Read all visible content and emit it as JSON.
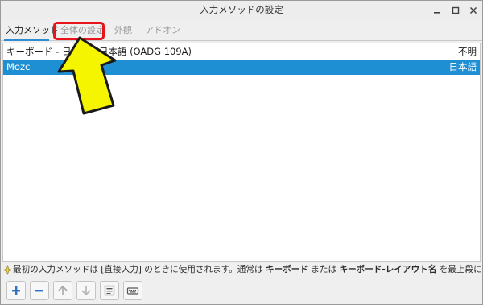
{
  "window": {
    "title": "入力メソッドの設定"
  },
  "tabs": [
    {
      "label": "入力メソッド",
      "active": true
    },
    {
      "label": "全体の設定",
      "active": false,
      "highlighted": true
    },
    {
      "label": "外観",
      "active": false
    },
    {
      "label": "アドオン",
      "active": false
    }
  ],
  "methods": [
    {
      "name": "キーボード - 日本語 - 日本語 (OADG 109A)",
      "language": "不明",
      "selected": false
    },
    {
      "name": "Mozc",
      "language": "日本語",
      "selected": true
    }
  ],
  "hint": {
    "prefix": "最初の入力メソッドは [直接入力] のときに使用されます。通常は ",
    "bold1": "キーボード",
    "mid": " または ",
    "bold2": "キーボード-レイアウト名",
    "suffix": " を最上段に指定してください。"
  },
  "toolbar": {
    "icons": [
      "add-icon",
      "remove-icon",
      "move-up-icon",
      "move-down-icon",
      "configure-icon",
      "keyboard-layout-icon"
    ]
  },
  "colors": {
    "selection": "#1f8fd4",
    "active_tab_underline": "#2d8fd0",
    "annotation_box": "#e8141c",
    "annotation_arrow": "#f5f500",
    "toolbar_icon": "#2f72c4"
  }
}
